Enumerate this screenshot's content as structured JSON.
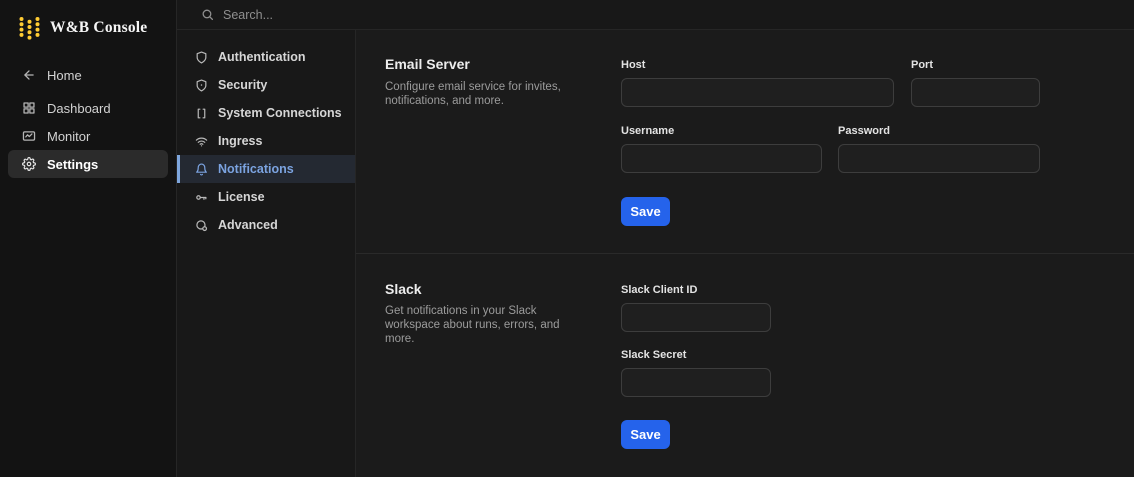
{
  "brand": {
    "title": "W&B Console",
    "logo_icon": "wandb-dots-logo",
    "logo_color": "#FFCC33"
  },
  "topbar": {
    "search_placeholder": "Search...",
    "search_icon": "magnifier-icon"
  },
  "primary_nav": {
    "items": [
      {
        "label": "Home",
        "icon": "arrow-left-icon",
        "selected": false
      },
      {
        "label": "Dashboard",
        "icon": "dashboard-grid-icon",
        "selected": false
      },
      {
        "label": "Monitor",
        "icon": "monitor-chart-icon",
        "selected": false
      },
      {
        "label": "Settings",
        "icon": "gear-icon",
        "selected": true
      }
    ]
  },
  "settings_nav": {
    "items": [
      {
        "label": "Authentication",
        "icon": "shield-icon",
        "selected": false
      },
      {
        "label": "Security",
        "icon": "shield-dot-icon",
        "selected": false
      },
      {
        "label": "System Connections",
        "icon": "brackets-icon",
        "selected": false
      },
      {
        "label": "Ingress",
        "icon": "wifi-icon",
        "selected": false
      },
      {
        "label": "Notifications",
        "icon": "bell-icon",
        "selected": true
      },
      {
        "label": "License",
        "icon": "key-icon",
        "selected": false
      },
      {
        "label": "Advanced",
        "icon": "advanced-circle-icon",
        "selected": false
      }
    ]
  },
  "sections": [
    {
      "title": "Email Server",
      "description": "Configure email service for invites, notifications, and more.",
      "fields": [
        {
          "label": "Host",
          "value": ""
        },
        {
          "label": "Port",
          "value": ""
        },
        {
          "label": "Username",
          "value": ""
        },
        {
          "label": "Password",
          "value": ""
        }
      ],
      "save_label": "Save"
    },
    {
      "title": "Slack",
      "description": "Get notifications in your Slack workspace about runs, errors, and more.",
      "fields": [
        {
          "label": "Slack Client ID",
          "value": ""
        },
        {
          "label": "Slack Secret",
          "value": ""
        }
      ],
      "save_label": "Save"
    }
  ],
  "colors": {
    "save_button_blue": "#2563eb",
    "selected_nav_text": "#7ba3e0",
    "selected_nav_border": "#7ea6dd",
    "brand_gold": "#FFCC33",
    "background": "#1b1b1b"
  }
}
